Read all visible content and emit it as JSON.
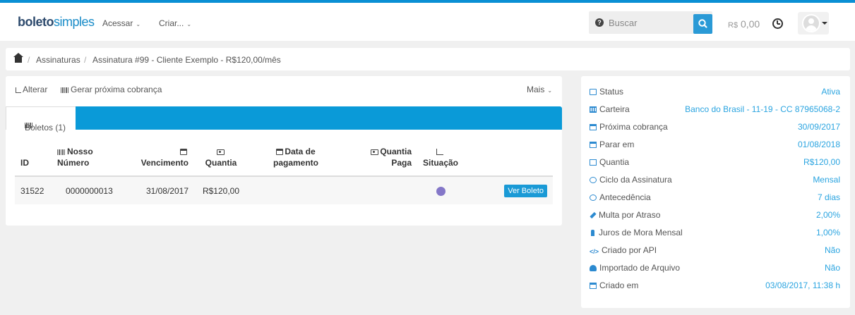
{
  "navbar": {
    "logo_bold": "boleto",
    "logo_light": "simples",
    "menu": [
      {
        "label": "Acessar"
      },
      {
        "label": "Criar..."
      }
    ],
    "search_placeholder": "Buscar",
    "balance_currency": "R$",
    "balance_value": "0,00"
  },
  "breadcrumb": {
    "items": [
      "Assinaturas",
      "Assinatura #99 - Cliente Exemplo - R$120,00/mês"
    ],
    "separator": "/"
  },
  "toolbar": {
    "edit_label": "Alterar",
    "generate_label": "Gerar próxima cobrança",
    "more_label": "Mais"
  },
  "tabs": [
    {
      "label": "Boletos (1)"
    }
  ],
  "table": {
    "headers": {
      "id": "ID",
      "nosso_numero_1": "Nosso",
      "nosso_numero_2": "Número",
      "vencimento": "Vencimento",
      "quantia": "Quantia",
      "data_pagamento_1": "Data de",
      "data_pagamento_2": "pagamento",
      "quantia_paga_1": "Quantia",
      "quantia_paga_2": "Paga",
      "situacao": "Situação"
    },
    "rows": [
      {
        "id": "31522",
        "nosso_numero": "0000000013",
        "vencimento": "31/08/2017",
        "quantia": "R$120,00",
        "data_pagamento": "",
        "quantia_paga": "",
        "situacao_color": "#8477c8",
        "action_label": "Ver Boleto"
      }
    ]
  },
  "details": [
    {
      "icon": "edit-icon",
      "label": "Status",
      "value": "Ativa"
    },
    {
      "icon": "bank-icon",
      "label": "Carteira",
      "value": "Banco do Brasil - 11-19 - CC 87965068-2"
    },
    {
      "icon": "calendar-icon",
      "label": "Próxima cobrança",
      "value": "30/09/2017"
    },
    {
      "icon": "calendar-icon",
      "label": "Parar em",
      "value": "01/08/2018"
    },
    {
      "icon": "cash-icon",
      "label": "Quantia",
      "value": "R$120,00"
    },
    {
      "icon": "clock-icon",
      "label": "Ciclo da Assinatura",
      "value": "Mensal"
    },
    {
      "icon": "clock-icon",
      "label": "Antecedência",
      "value": "7 dias"
    },
    {
      "icon": "wrench-icon",
      "label": "Multa por Atraso",
      "value": "2,00%"
    },
    {
      "icon": "pushpin-icon",
      "label": "Juros de Mora Mensal",
      "value": "1,00%"
    },
    {
      "icon": "code-icon",
      "label": "Criado por API",
      "value": "Não"
    },
    {
      "icon": "cloud-upload-icon",
      "label": "Importado de Arquivo",
      "value": "Não"
    },
    {
      "icon": "calendar-icon",
      "label": "Criado em",
      "value": "03/08/2017, 11:38 h"
    }
  ],
  "colors": {
    "accent": "#0a9ad8",
    "link": "#2aa4e0",
    "status_dot": "#8477c8"
  }
}
